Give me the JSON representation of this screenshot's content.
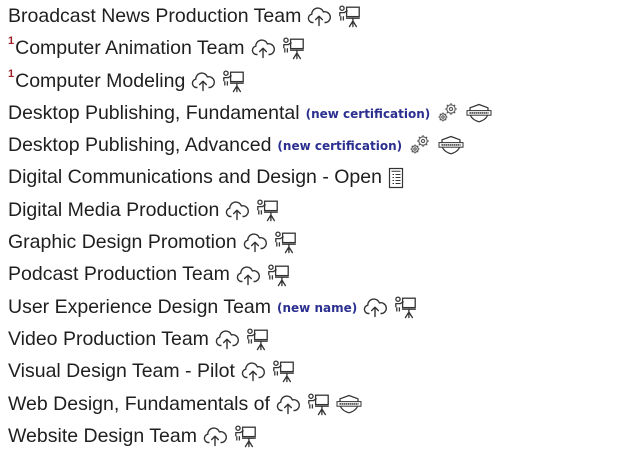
{
  "items": [
    {
      "sup": "",
      "name": "Broadcast News Production Team",
      "note": "",
      "icons": [
        "cloud-upload-icon",
        "presentation-icon"
      ]
    },
    {
      "sup": "1",
      "name": "Computer Animation Team",
      "note": "",
      "icons": [
        "cloud-upload-icon",
        "presentation-icon"
      ]
    },
    {
      "sup": "1",
      "name": "Computer Modeling",
      "note": "",
      "icons": [
        "cloud-upload-icon",
        "presentation-icon"
      ]
    },
    {
      "sup": "",
      "name": "Desktop Publishing, Fundamental",
      "note": "(new certification)",
      "icons": [
        "gears-icon",
        "certified-icon"
      ]
    },
    {
      "sup": "",
      "name": "Desktop Publishing, Advanced",
      "note": "(new certification)",
      "icons": [
        "gears-icon",
        "certified-icon"
      ]
    },
    {
      "sup": "",
      "name": "Digital Communications and Design - Open",
      "note": "",
      "icons": [
        "test-icon"
      ]
    },
    {
      "sup": "",
      "name": "Digital Media Production",
      "note": "",
      "icons": [
        "cloud-upload-icon",
        "presentation-icon"
      ]
    },
    {
      "sup": "",
      "name": "Graphic Design Promotion",
      "note": "",
      "icons": [
        "cloud-upload-icon",
        "presentation-icon"
      ]
    },
    {
      "sup": "",
      "name": "Podcast Production Team",
      "note": "",
      "icons": [
        "cloud-upload-icon",
        "presentation-icon"
      ]
    },
    {
      "sup": "",
      "name": "User Experience Design Team",
      "note": "(new name)",
      "icons": [
        "cloud-upload-icon",
        "presentation-icon"
      ]
    },
    {
      "sup": "",
      "name": "Video Production Team",
      "note": "",
      "icons": [
        "cloud-upload-icon",
        "presentation-icon"
      ]
    },
    {
      "sup": "",
      "name": "Visual Design Team - Pilot",
      "note": "",
      "icons": [
        "cloud-upload-icon",
        "presentation-icon"
      ]
    },
    {
      "sup": "",
      "name": "Web Design, Fundamentals of",
      "note": "",
      "icons": [
        "cloud-upload-icon",
        "presentation-icon",
        "certified-icon"
      ]
    },
    {
      "sup": "",
      "name": "Website Design Team",
      "note": "",
      "icons": [
        "cloud-upload-icon",
        "presentation-icon"
      ]
    }
  ],
  "colors": {
    "text": "#1f1f1f",
    "superscript": "#a01f24",
    "note": "#2b2f8f"
  }
}
